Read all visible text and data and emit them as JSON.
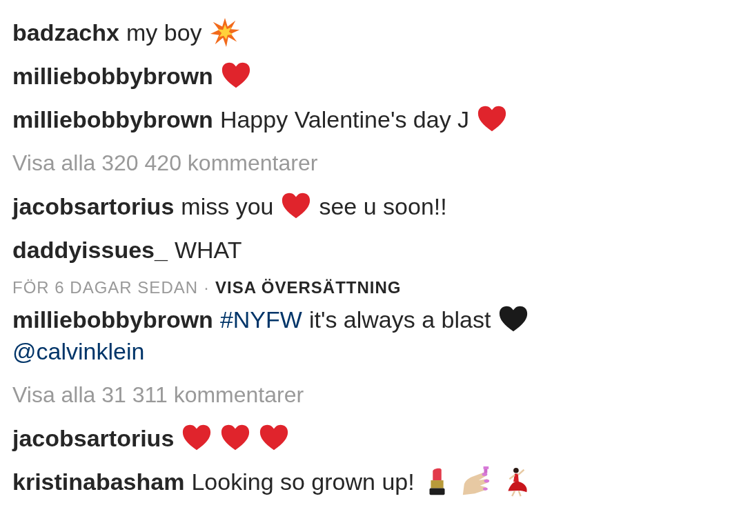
{
  "comments": [
    {
      "kind": "comment",
      "user": "badzachx",
      "parts": [
        {
          "kind": "text",
          "text": "my boy"
        },
        {
          "kind": "collision"
        }
      ]
    },
    {
      "kind": "comment",
      "user": "milliebobbybrown",
      "parts": [
        {
          "kind": "heart"
        }
      ]
    },
    {
      "kind": "comment",
      "user": "milliebobbybrown",
      "parts": [
        {
          "kind": "text",
          "text": "Happy Valentine's day J"
        },
        {
          "kind": "heart"
        }
      ]
    },
    {
      "kind": "view_all",
      "text": "Visa alla 320 420 kommentarer"
    },
    {
      "kind": "comment",
      "user": "jacobsartorius",
      "parts": [
        {
          "kind": "text",
          "text": "miss you"
        },
        {
          "kind": "heart"
        },
        {
          "kind": "text",
          "text": "see u soon!!"
        }
      ]
    },
    {
      "kind": "comment",
      "user": "daddyissues_",
      "parts": [
        {
          "kind": "text",
          "text": "WHAT"
        }
      ]
    },
    {
      "kind": "meta",
      "time": "FÖR 6 DAGAR SEDAN",
      "separator": "·",
      "action": "VISA ÖVERSÄTTNING"
    },
    {
      "kind": "comment",
      "user": "milliebobbybrown",
      "parts": [
        {
          "kind": "hashtag",
          "text": "#NYFW"
        },
        {
          "kind": "text",
          "text": "it's always a blast"
        },
        {
          "kind": "black-heart"
        },
        {
          "kind": "mention",
          "text": "@calvinklein"
        }
      ]
    },
    {
      "kind": "view_all",
      "text": "Visa alla 31 311 kommentarer"
    },
    {
      "kind": "comment",
      "user": "jacobsartorius",
      "parts": [
        {
          "kind": "heart"
        },
        {
          "kind": "heart"
        },
        {
          "kind": "heart"
        }
      ]
    },
    {
      "kind": "comment",
      "user": "kristinabasham",
      "parts": [
        {
          "kind": "text",
          "text": "Looking so grown up!"
        },
        {
          "kind": "lipstick"
        },
        {
          "kind": "nails"
        },
        {
          "kind": "dancer"
        }
      ]
    }
  ]
}
